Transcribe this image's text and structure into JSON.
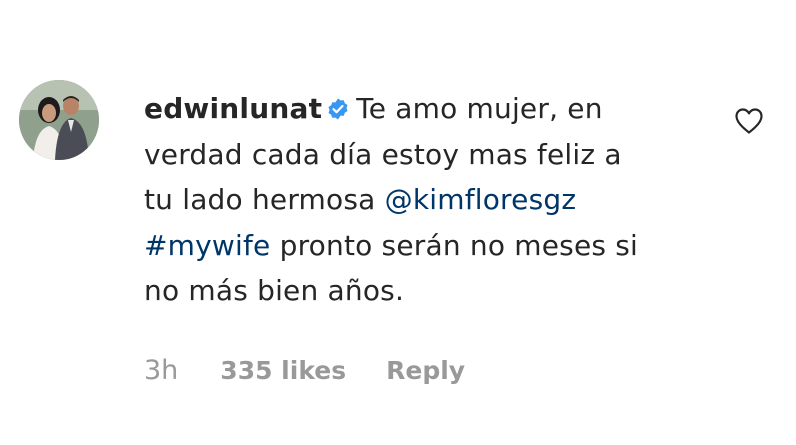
{
  "comment": {
    "username": "edwinlunat",
    "verified_icon": "verified-badge-icon",
    "text_lines": [
      "Te amo mujer, en",
      "verdad cada día estoy mas feliz a",
      "tu lado hermosa",
      "pronto serán no meses si",
      "no más bien años."
    ],
    "mention": "@kimfloresgz",
    "hashtag": "#mywife",
    "like_icon": "heart-outline-icon",
    "time": "3h",
    "likes": "335 likes",
    "reply_label": "Reply"
  },
  "colors": {
    "text": "#262626",
    "link": "#003569",
    "meta": "#999999",
    "verified": "#3897f0"
  }
}
